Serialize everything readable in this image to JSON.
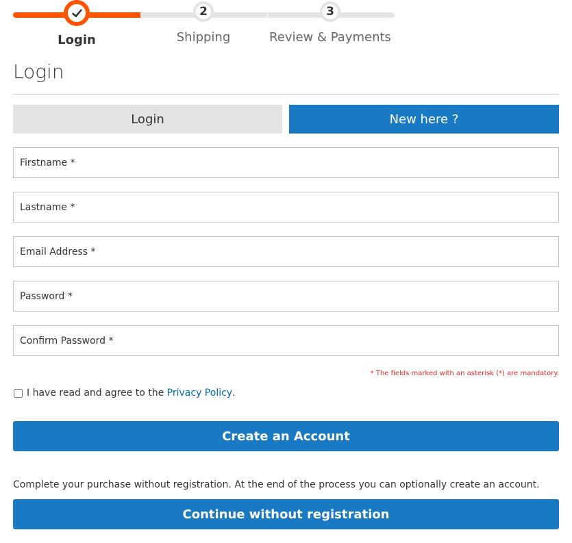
{
  "progress": {
    "steps": [
      {
        "label": "Login",
        "number": "",
        "state": "completed"
      },
      {
        "label": "Shipping",
        "number": "2",
        "state": "pending"
      },
      {
        "label": "Review & Payments",
        "number": "3",
        "state": "pending"
      }
    ],
    "completed_fraction": 0.333
  },
  "page_title": "Login",
  "tabs": {
    "login_label": "Login",
    "new_label": "New here ?"
  },
  "form": {
    "firstname_placeholder": "Firstname *",
    "lastname_placeholder": "Lastname *",
    "email_placeholder": "Email Address *",
    "password_placeholder": "Password *",
    "confirm_password_placeholder": "Confirm Password *",
    "mandatory_note": "* The fields marked with an asterisk (*) are mandatory.",
    "agree_text": "I have read and agree to the",
    "privacy_link": "Privacy Policy",
    "agree_suffix": ".",
    "agree_checked": false,
    "create_button": "Create an Account"
  },
  "guest": {
    "note": "Complete your purchase without registration. At the end of the process you can optionally create an account.",
    "button": "Continue without registration"
  },
  "colors": {
    "accent": "#ff5501",
    "primary": "#1979c3",
    "link": "#006bb4",
    "error": "#e02b27"
  },
  "icons": {
    "step1": "check-icon"
  }
}
